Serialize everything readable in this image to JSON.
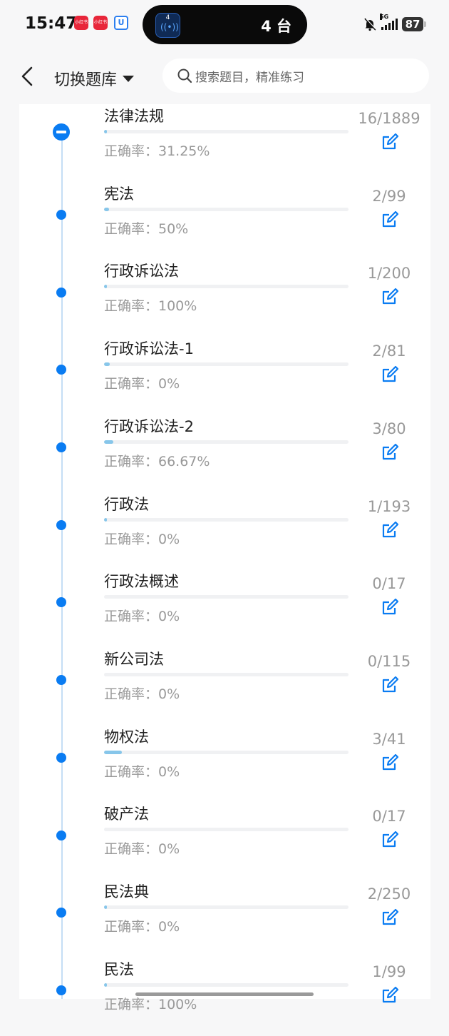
{
  "status_bar": {
    "time": "15:47",
    "app_icon_1": "小红书",
    "app_icon_2": "小红书",
    "app_icon_3": "U",
    "island_badge": "4",
    "island_text": "4 台",
    "network": "5G",
    "battery": "87"
  },
  "header": {
    "title": "切换题库",
    "search_placeholder": "搜索题目，精准练习"
  },
  "items": [
    {
      "name": "法律法规",
      "accuracy": "正确率：31.25%",
      "count": "16/1889",
      "progress": 0.0085
    },
    {
      "name": "宪法",
      "accuracy": "正确率：50%",
      "count": "2/99",
      "progress": 0.0202
    },
    {
      "name": "行政诉讼法",
      "accuracy": "正确率：100%",
      "count": "1/200",
      "progress": 0.005
    },
    {
      "name": "行政诉讼法-1",
      "accuracy": "正确率：0%",
      "count": "2/81",
      "progress": 0.0247
    },
    {
      "name": "行政诉讼法-2",
      "accuracy": "正确率：66.67%",
      "count": "3/80",
      "progress": 0.0375
    },
    {
      "name": "行政法",
      "accuracy": "正确率：0%",
      "count": "1/193",
      "progress": 0.0052
    },
    {
      "name": "行政法概述",
      "accuracy": "正确率：0%",
      "count": "0/17",
      "progress": 0
    },
    {
      "name": "新公司法",
      "accuracy": "正确率：0%",
      "count": "0/115",
      "progress": 0
    },
    {
      "name": "物权法",
      "accuracy": "正确率：0%",
      "count": "3/41",
      "progress": 0.0732
    },
    {
      "name": "破产法",
      "accuracy": "正确率：0%",
      "count": "0/17",
      "progress": 0
    },
    {
      "name": "民法典",
      "accuracy": "正确率：0%",
      "count": "2/250",
      "progress": 0.008
    },
    {
      "name": "民法",
      "accuracy": "正确率：100%",
      "count": "1/99",
      "progress": 0.0101
    }
  ],
  "colors": {
    "accent": "#0a7cf2",
    "progress": "#87c6ea"
  }
}
